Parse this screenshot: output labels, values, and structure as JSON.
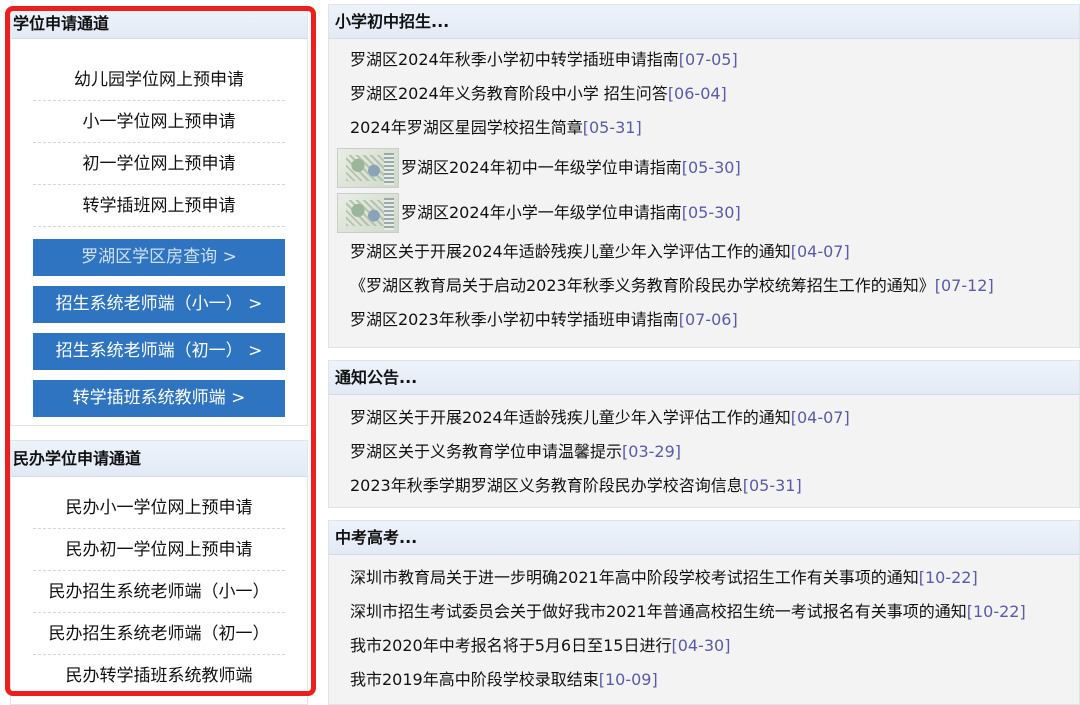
{
  "sidebar": {
    "public": {
      "title": "学位申请通道",
      "links": [
        "幼儿园学位网上预申请",
        "小一学位网上预申请",
        "初一学位网上预申请",
        "转学插班网上预申请"
      ],
      "buttons": [
        "罗湖区学区房查询 >",
        "招生系统老师端（小一） >",
        "招生系统老师端（初一） >",
        "转学插班系统教师端 >"
      ]
    },
    "private": {
      "title": "民办学位申请通道",
      "links": [
        "民办小一学位网上预申请",
        "民办初一学位网上预申请",
        "民办招生系统老师端（小一）",
        "民办招生系统老师端（初一）",
        "民办转学插班系统教师端"
      ]
    }
  },
  "sections": {
    "admission": {
      "title": "小学初中招生...",
      "items": [
        {
          "text": "罗湖区2024年秋季小学初中转学插班申请指南",
          "date": "[07-05]"
        },
        {
          "text": "罗湖区2024年义务教育阶段中小学 招生问答",
          "date": "[06-04]"
        },
        {
          "text": "2024年罗湖区星园学校招生简章",
          "date": "[05-31]"
        },
        {
          "text": "罗湖区2024年初中一年级学位申请指南",
          "date": "[05-30]"
        },
        {
          "text": "罗湖区2024年小学一年级学位申请指南",
          "date": "[05-30]"
        },
        {
          "text": "罗湖区关于开展2024年适龄残疾儿童少年入学评估工作的通知",
          "date": "[04-07]"
        },
        {
          "text": "《罗湖区教育局关于启动2023年秋季义务教育阶段民办学校统筹招生工作的通知》",
          "date": "[07-12]"
        },
        {
          "text": "罗湖区2023年秋季小学初中转学插班申请指南",
          "date": "[07-06]"
        }
      ]
    },
    "notices": {
      "title": "通知公告...",
      "items": [
        {
          "text": "罗湖区关于开展2024年适龄残疾儿童少年入学评估工作的通知",
          "date": "[04-07]"
        },
        {
          "text": "罗湖区关于义务教育学位申请温馨提示",
          "date": "[03-29]"
        },
        {
          "text": "2023年秋季学期罗湖区义务教育阶段民办学校咨询信息",
          "date": "[05-31]"
        }
      ]
    },
    "exams": {
      "title": "中考高考...",
      "items": [
        {
          "text": "深圳市教育局关于进一步明确2021年高中阶段学校考试招生工作有关事项的通知",
          "date": "[10-22]"
        },
        {
          "text": "深圳市招生考试委员会关于做好我市2021年普通高校招生统一考试报名有关事项的通知",
          "date": "[10-22]"
        },
        {
          "text": "我市2020年中考报名将于5月6日至15日进行",
          "date": "[04-30]"
        },
        {
          "text": "我市2019年高中阶段学校录取结束",
          "date": "[10-09]"
        }
      ]
    }
  },
  "colors": {
    "button_blue": "#2f74c0",
    "highlight_red": "#ee1e1e",
    "date_color": "#5a5aa8"
  }
}
